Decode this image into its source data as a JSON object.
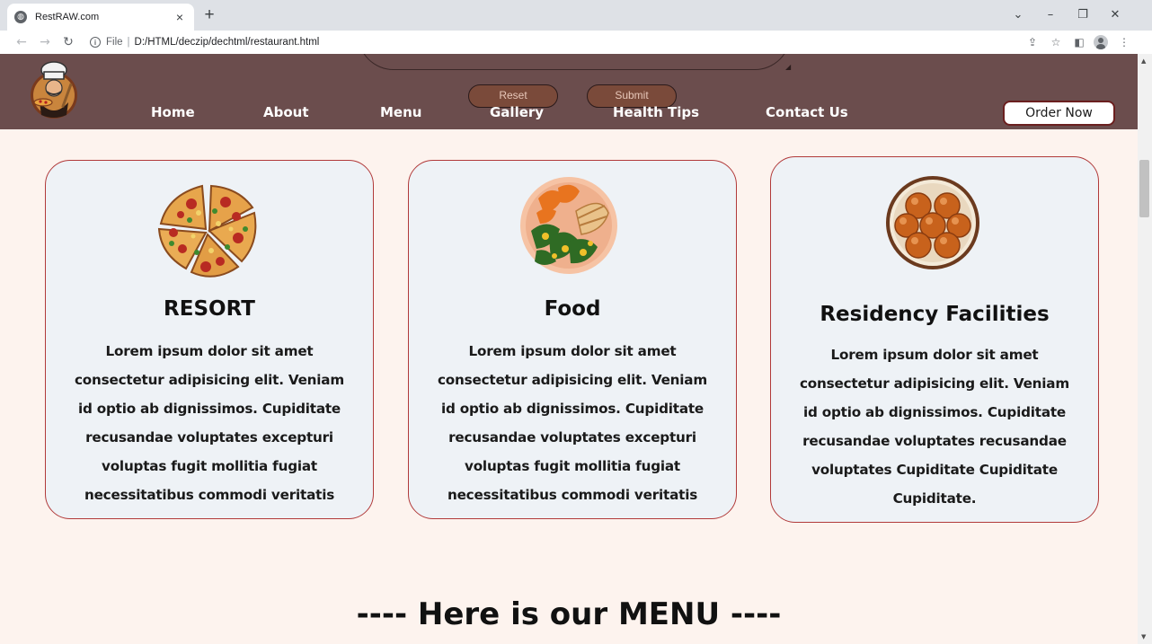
{
  "browser": {
    "tab_title": "RestRAW.com",
    "tab_close": "×",
    "new_tab": "+",
    "favicon": "globe-icon",
    "scheme": "File",
    "url": "D:/HTML/deczip/dechtml/restaurant.html",
    "window_controls": [
      "chevron-down-icon",
      "minimize-icon",
      "restore-icon",
      "close-icon"
    ]
  },
  "header": {
    "form_buttons": {
      "reset": "Reset",
      "submit": "Submit"
    },
    "nav": [
      "Home",
      "About",
      "Menu",
      "Gallery",
      "Health Tips",
      "Contact Us"
    ],
    "order_now": "Order Now",
    "logo": "chef-logo-icon"
  },
  "cards": [
    {
      "image": "pizza-image",
      "title": "RESORT",
      "text": "Lorem ipsum dolor sit amet consectetur adipisicing elit. Veniam id optio ab dignissimos. Cupiditate recusandae voluptates excepturi voluptas fugit mollitia fugiat necessitatibus commodi veritatis"
    },
    {
      "image": "salad-plate-image",
      "title": "Food",
      "text": "Lorem ipsum dolor sit amet consectetur adipisicing elit. Veniam id optio ab dignissimos. Cupiditate recusandae voluptates excepturi voluptas fugit mollitia fugiat necessitatibus commodi veritatis"
    },
    {
      "image": "gulab-jamun-bowl-image",
      "title": "Residency Facilities",
      "text": "Lorem ipsum dolor sit amet consectetur adipisicing elit. Veniam id optio ab dignissimos. Cupiditate recusandae voluptates recusandae voluptates Cupiditate Cupiditate Cupiditate."
    }
  ],
  "menu_heading": "---- Here is our MENU ----",
  "colors": {
    "header_bg": "#6b4d4d",
    "page_bg": "#fdf3ee",
    "card_bg": "#eef2f6",
    "card_border": "#b13a3a",
    "form_button_bg": "#7a4a3a"
  }
}
